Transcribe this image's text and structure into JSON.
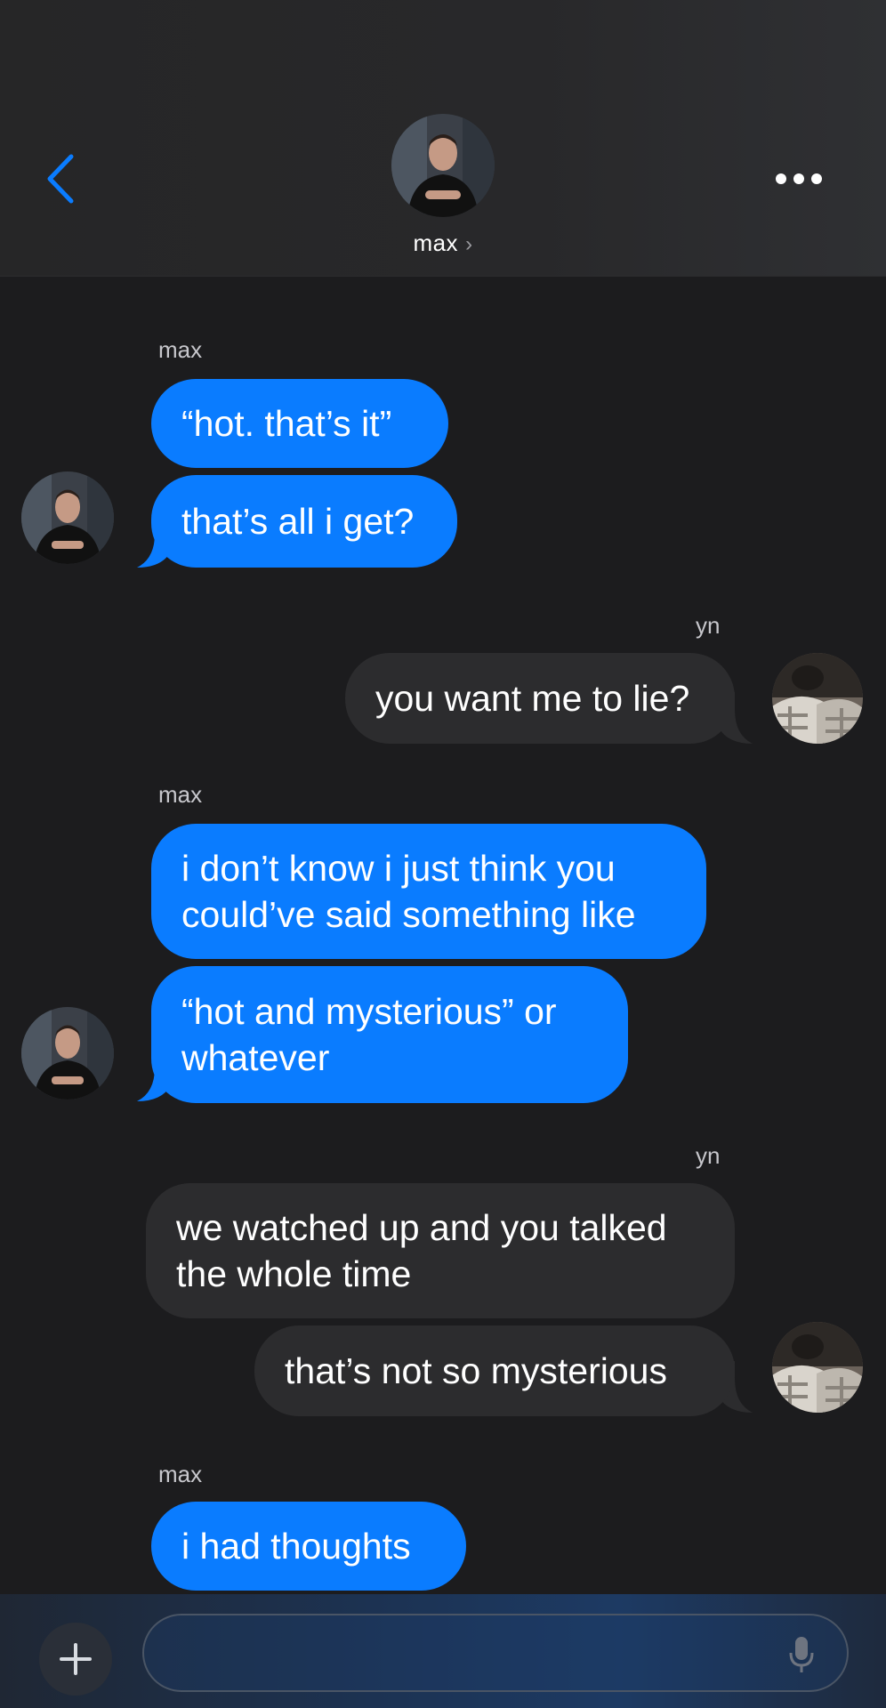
{
  "header": {
    "contact_name": "max",
    "chevron": "›",
    "icons": {
      "back": "chevron-left-icon",
      "more": "ellipsis-icon"
    },
    "accent_color": "#0a7cff"
  },
  "messages": [
    {
      "sender": "max",
      "bubbles": [
        "“hot. that’s it”",
        "that’s all i get?"
      ]
    },
    {
      "sender": "yn",
      "bubbles": [
        "you want me to lie?"
      ]
    },
    {
      "sender": "max",
      "bubbles": [
        "i don’t know i just think you\ncould’ve said something like",
        "“hot and mysterious” or\nwhatever"
      ]
    },
    {
      "sender": "yn",
      "bubbles": [
        "we watched up and you talked\nthe whole time",
        "that’s not so mysterious"
      ]
    },
    {
      "sender": "max",
      "bubbles": [
        "i had thoughts"
      ]
    }
  ],
  "composer": {
    "placeholder": "",
    "icons": {
      "add": "plus-icon",
      "mic": "microphone-icon"
    }
  },
  "colors": {
    "outgoing_bubble": "#0a7cff",
    "incoming_bubble": "#2c2c2e",
    "background": "#1c1c1e"
  }
}
